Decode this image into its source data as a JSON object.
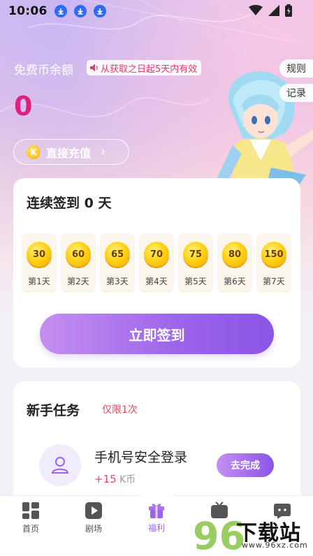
{
  "status_bar": {
    "time": "10:06",
    "icons": [
      "download-icon",
      "download-icon",
      "download-icon",
      "wifi-icon",
      "signal-icon",
      "battery-charging-icon"
    ]
  },
  "balance": {
    "label": "免费币余额",
    "validity": "从获取之日起5天内有效",
    "value": "0"
  },
  "side_buttons": {
    "rules": "规则",
    "record": "记录"
  },
  "recharge": {
    "coin_letter": "K",
    "label": "直接充值",
    "chevron": "›"
  },
  "signin": {
    "title": "连续签到 0 天",
    "days": [
      {
        "reward": "30",
        "label": "第1天"
      },
      {
        "reward": "60",
        "label": "第2天"
      },
      {
        "reward": "65",
        "label": "第3天"
      },
      {
        "reward": "70",
        "label": "第4天"
      },
      {
        "reward": "75",
        "label": "第5天"
      },
      {
        "reward": "80",
        "label": "第6天"
      },
      {
        "reward": "150",
        "label": "第7天"
      }
    ],
    "button": "立即签到"
  },
  "tasks": {
    "title": "新手任务",
    "limit": "仅限1次",
    "items": [
      {
        "name": "手机号安全登录",
        "reward_prefix": "+",
        "reward_amount": "15",
        "reward_unit": " K币",
        "action": "去完成"
      }
    ]
  },
  "tab_bar": {
    "tabs": [
      {
        "label": "首页",
        "icon": "home-grid-icon"
      },
      {
        "label": "剧场",
        "icon": "play-icon"
      },
      {
        "label": "福利",
        "icon": "gift-icon",
        "active": true
      },
      {
        "label": "",
        "icon": "tv-icon"
      },
      {
        "label": "",
        "icon": "chat-icon"
      }
    ]
  },
  "watermark": {
    "text": "下载站",
    "digits": "96",
    "url": "www.96xz.com"
  },
  "colors": {
    "accent": "#9c64ea",
    "balance": "#e0207a",
    "highlight": "#e64a5f",
    "coin": "#ffd21a"
  }
}
